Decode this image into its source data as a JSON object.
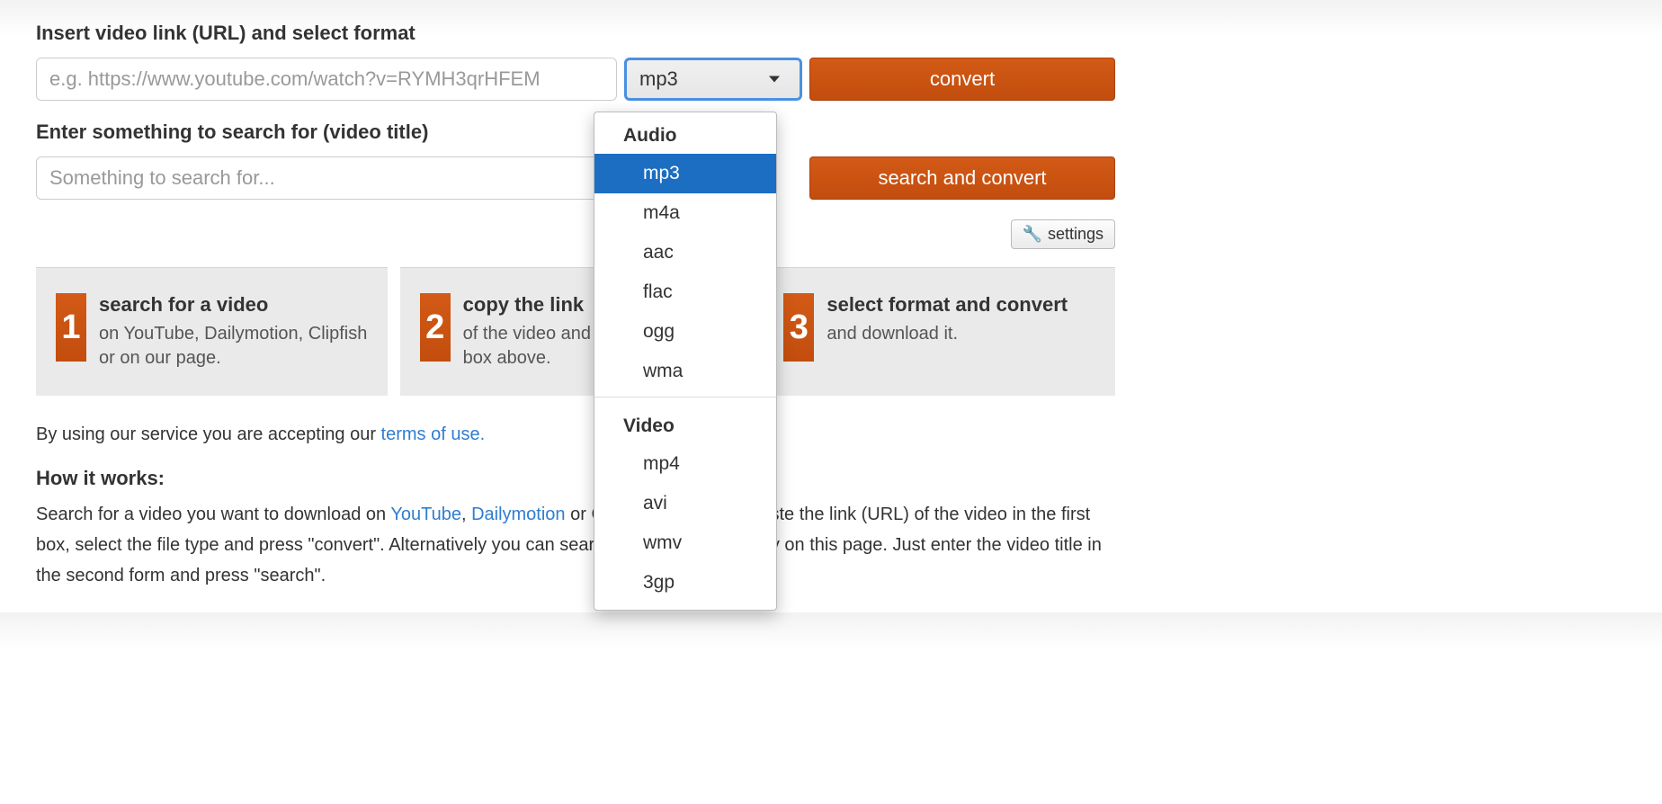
{
  "section1_label": "Insert video link (URL) and select format",
  "url_input": {
    "placeholder": "e.g. https://www.youtube.com/watch?v=RYMH3qrHFEM",
    "value": ""
  },
  "format_select": {
    "selected": "mp3",
    "groups": [
      {
        "label": "Audio",
        "items": [
          "mp3",
          "m4a",
          "aac",
          "flac",
          "ogg",
          "wma"
        ]
      },
      {
        "label": "Video",
        "items": [
          "mp4",
          "avi",
          "wmv",
          "3gp"
        ]
      }
    ]
  },
  "convert_button": "convert",
  "section2_label": "Enter something to search for (video title)",
  "search_input": {
    "placeholder": "Something to search for...",
    "value": ""
  },
  "search_button": "search and convert",
  "settings_button": "settings",
  "steps": [
    {
      "num": "1",
      "title": "search for a video",
      "desc": "on YouTube, Dailymotion, Clipfish or on our page."
    },
    {
      "num": "2",
      "title": "copy the link",
      "desc": "of the video and paste it into the box above."
    },
    {
      "num": "3",
      "title": "select format and convert",
      "desc": "and download it."
    }
  ],
  "terms": {
    "prefix": "By using our service you are accepting our ",
    "link": "terms of use."
  },
  "howitworks": {
    "title": "How it works:",
    "body_pre": "Search for a video you want to download on ",
    "link1": "YouTube",
    "sep1": ", ",
    "link2": "Dailymotion",
    "body_mid": " or ",
    "body_post": " and copy & paste the link (URL) of the video in the first box, select the file type and press \"convert\". Alternatively you can search for the video directly on this page. Just enter the video title in the second form and press \"search\"."
  }
}
